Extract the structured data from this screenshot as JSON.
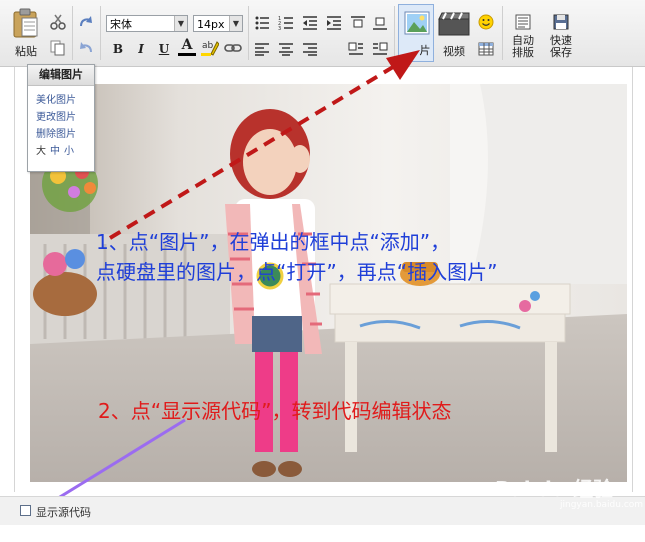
{
  "toolbar": {
    "paste_label": "粘贴",
    "font_family": "宋体",
    "font_size": "14px",
    "bold_label": "B",
    "italic_label": "I",
    "underline_label": "U",
    "fontcolor_label": "A",
    "image_label": "片",
    "video_label": "视频",
    "autoformat_label": "自动\n排版",
    "quicksave_label": "快速\n保存"
  },
  "popup": {
    "title": "编辑图片",
    "items": [
      "美化图片",
      "更改图片",
      "删除图片"
    ],
    "sizes": [
      "大",
      "中",
      "小"
    ]
  },
  "annotations": {
    "step1_line1": "1、点“图片”，在弹出的框中点“添加”，",
    "step1_line2": "点硬盘里的图片，点“打开”，再点“插入图片”",
    "step2": "2、点“显示源代码”，转到代码编辑状态"
  },
  "status": {
    "source_code_label": "显示源代码"
  },
  "watermark": {
    "text": "Bai du 经验",
    "sub": "jingyan.baidu.com"
  },
  "colors": {
    "step1": "#1f3fd8",
    "step2": "#e01b1b",
    "arrow_red": "#c01818",
    "arrow_purple": "#9b6cf0"
  }
}
